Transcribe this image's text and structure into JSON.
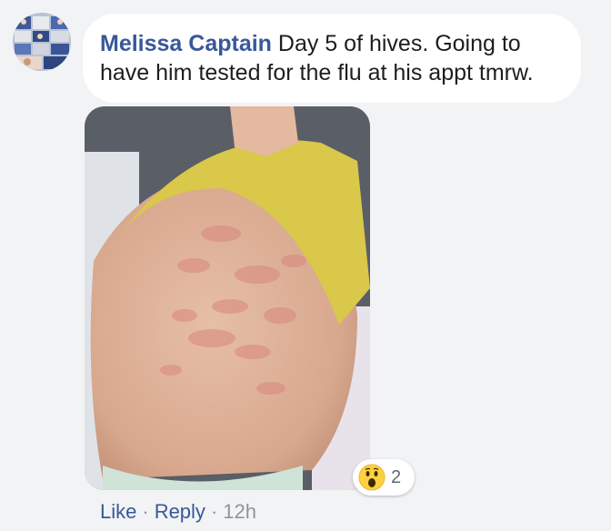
{
  "comment": {
    "author": "Melissa Captain",
    "text": "Day 5 of hives. Going to have him tested for the flu at his appt tmrw."
  },
  "reactions": {
    "icon": "wow-emoji-icon",
    "count": "2"
  },
  "actions": {
    "like_label": "Like",
    "separator": "·",
    "reply_label": "Reply",
    "timestamp": "12h"
  },
  "colors": {
    "author": "#385898",
    "background": "#f2f3f5",
    "bubble": "#ffffff",
    "meta": "#90949c"
  }
}
